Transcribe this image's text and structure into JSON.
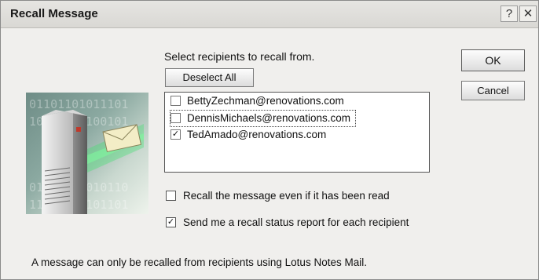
{
  "window": {
    "title": "Recall Message",
    "help_glyph": "?",
    "close_glyph": "✕"
  },
  "instruction": "Select recipients to recall from.",
  "buttons": {
    "deselect_all": "Deselect All",
    "ok": "OK",
    "cancel": "Cancel"
  },
  "recipients": [
    {
      "email": "BettyZechman@renovations.com",
      "checked": false
    },
    {
      "email": "DennisMichaels@renovations.com",
      "checked": false
    },
    {
      "email": "TedAmado@renovations.com",
      "checked": true
    }
  ],
  "options": [
    {
      "label": "Recall the message even if it has been read",
      "checked": false
    },
    {
      "label": "Send me a recall status report for each recipient",
      "checked": true
    }
  ],
  "footer_note": "A message can only be recalled from recipients using Lotus Notes Mail.",
  "illustration": {
    "bits": [
      "01101101011101",
      "10110101100101",
      "01101011010110",
      "11010110101101"
    ]
  },
  "check_mark": "✓",
  "colors": {
    "dialog_bg": "#f0efed",
    "envelope": "#f3edc6",
    "data_stream": "#39e36b"
  }
}
